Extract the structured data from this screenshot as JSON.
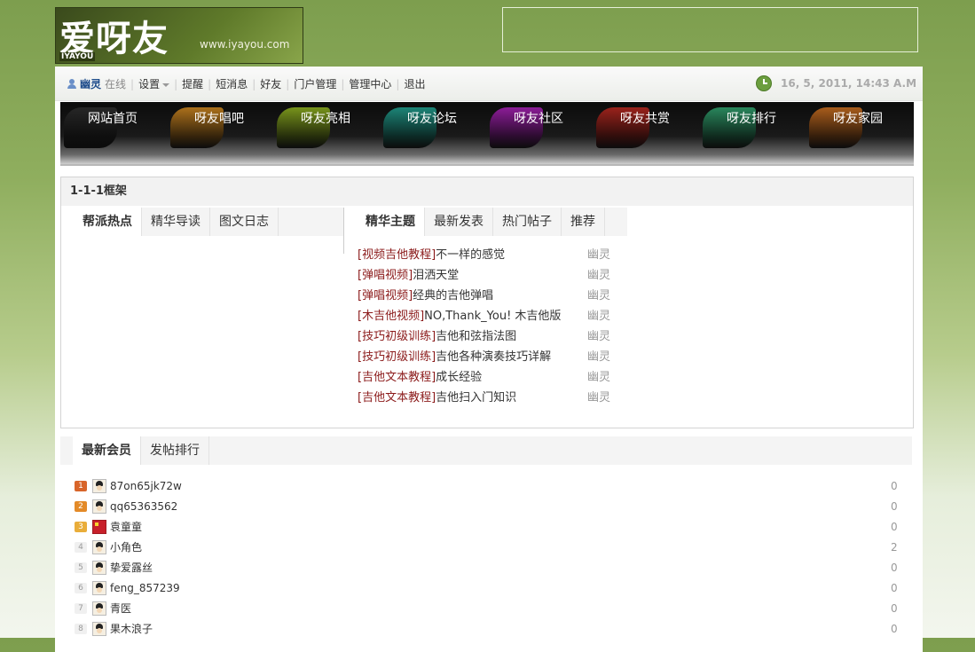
{
  "logo": {
    "main": "爱呀友",
    "sub": "IYAYOU",
    "url": "www.iyayou.com"
  },
  "userbar": {
    "username": "幽灵",
    "status": "在线",
    "links": [
      "设置",
      "提醒",
      "短消息",
      "好友",
      "门户管理",
      "管理中心",
      "退出"
    ],
    "datetime": "16, 5, 2011, 14:43 A.M"
  },
  "nav": {
    "items": [
      {
        "label": "网站首页",
        "color": "#2b2b2b"
      },
      {
        "label": "呀友唱吧",
        "color": "#c8821e"
      },
      {
        "label": "呀友亮相",
        "color": "#8aab1e"
      },
      {
        "label": "呀友论坛",
        "color": "#1f9a8a"
      },
      {
        "label": "呀友社区",
        "color": "#a21fb0"
      },
      {
        "label": "呀友共赏",
        "color": "#b3261e"
      },
      {
        "label": "呀友排行",
        "color": "#2e9c6a"
      },
      {
        "label": "呀友家园",
        "color": "#c46a1e"
      }
    ]
  },
  "frame": {
    "title": "1-1-1框架",
    "left_tabs": [
      "帮派热点",
      "精华导读",
      "图文日志"
    ],
    "right_tabs": [
      "精华主题",
      "最新发表",
      "热门帖子",
      "推荐"
    ],
    "threads": [
      {
        "category": "[视频吉他教程]",
        "title": "不一样的感觉",
        "author": "幽灵"
      },
      {
        "category": "[弹唱视频]",
        "title": "泪洒天堂",
        "author": "幽灵"
      },
      {
        "category": "[弹唱视频]",
        "title": "经典的吉他弹唱",
        "author": "幽灵"
      },
      {
        "category": "[木吉他视频]",
        "title": "NO,Thank_You! 木吉他版",
        "author": "幽灵"
      },
      {
        "category": "[技巧初级训练]",
        "title": "吉他和弦指法图",
        "author": "幽灵"
      },
      {
        "category": "[技巧初级训练]",
        "title": "吉他各种演奏技巧详解",
        "author": "幽灵"
      },
      {
        "category": "[吉他文本教程]",
        "title": "成长经验",
        "author": "幽灵"
      },
      {
        "category": "[吉他文本教程]",
        "title": "吉他扫入门知识",
        "author": "幽灵"
      }
    ]
  },
  "members": {
    "tabs": [
      "最新会员",
      "发帖排行"
    ],
    "list": [
      {
        "rank": "1",
        "name": "87on65jk72w",
        "count": "0"
      },
      {
        "rank": "2",
        "name": "qq65363562",
        "count": "0"
      },
      {
        "rank": "3",
        "name": "袁童童",
        "count": "0"
      },
      {
        "rank": "4",
        "name": "小角色",
        "count": "2"
      },
      {
        "rank": "5",
        "name": "挚爱露丝",
        "count": "0"
      },
      {
        "rank": "6",
        "name": "feng_857239",
        "count": "0"
      },
      {
        "rank": "7",
        "name": "青医",
        "count": "0"
      },
      {
        "rank": "8",
        "name": "果木浪子",
        "count": "0"
      }
    ]
  }
}
